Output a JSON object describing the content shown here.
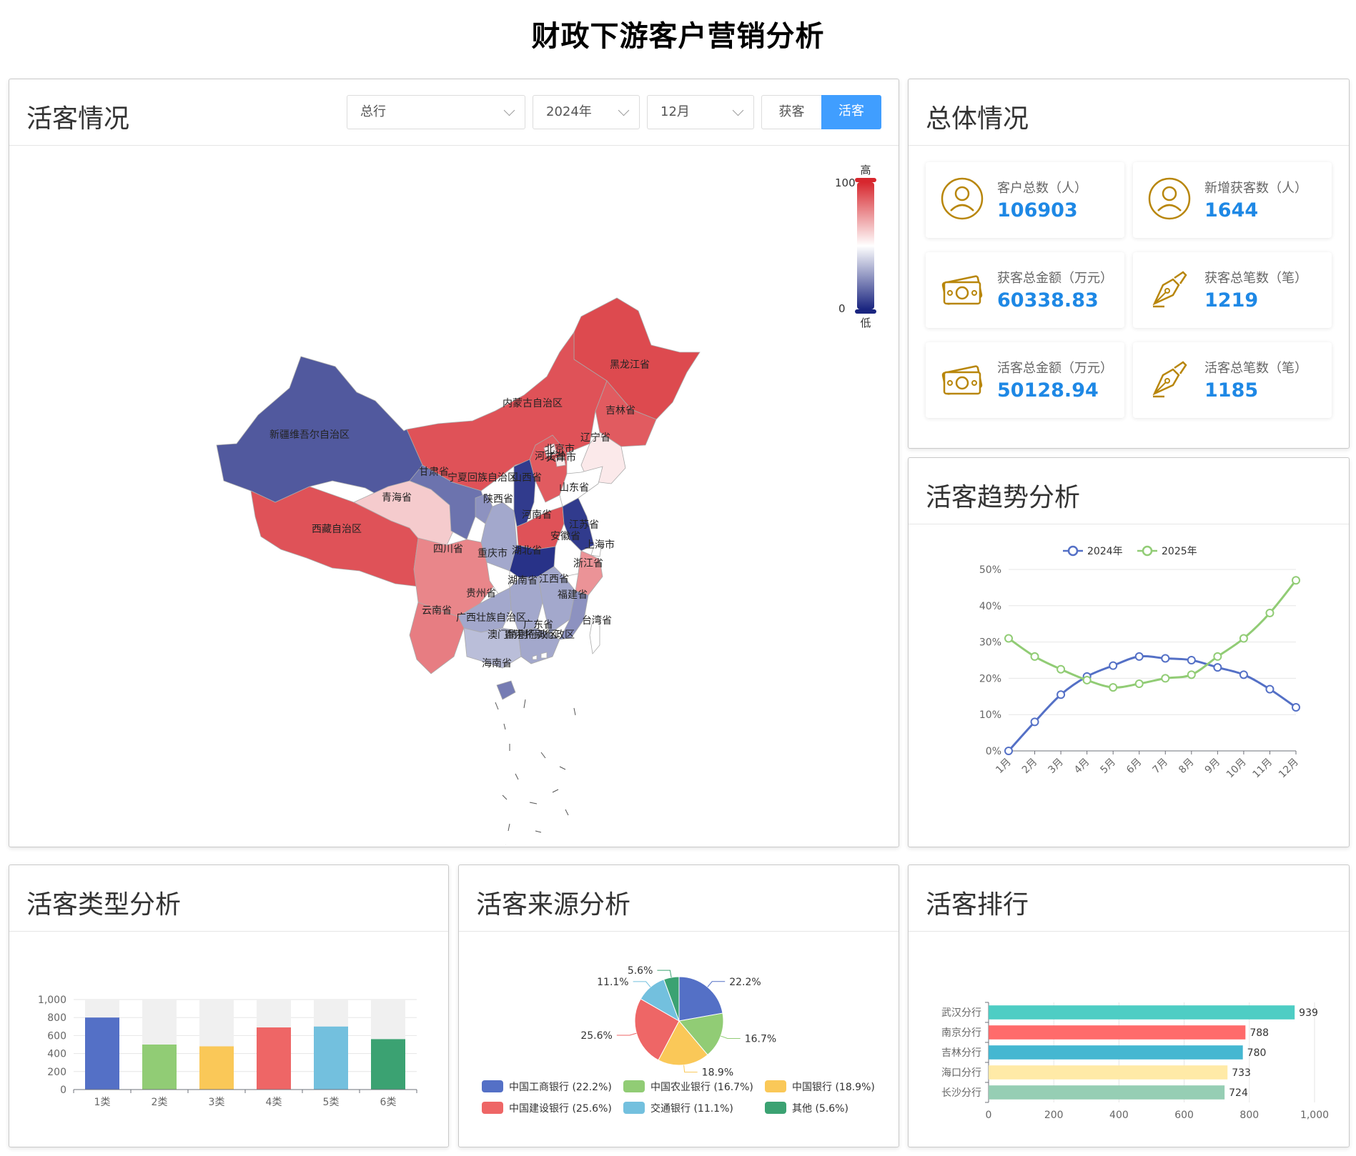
{
  "page_title": "财政下游客户营销分析",
  "map_card": {
    "title": "活客情况",
    "filters": {
      "branch": "总行",
      "year": "2024年",
      "month": "12月"
    },
    "toggle": [
      {
        "label": "获客",
        "active": false
      },
      {
        "label": "活客",
        "active": true
      }
    ],
    "legend": {
      "max_label": "100",
      "min_label": "0",
      "high_label": "高",
      "low_label": "低"
    },
    "provinces": [
      {
        "name": "黑龙江省",
        "level": 0.92
      },
      {
        "name": "吉林省",
        "level": 0.88
      },
      {
        "name": "辽宁省",
        "level": 0.55
      },
      {
        "name": "内蒙古自治区",
        "level": 0.9
      },
      {
        "name": "新疆维吾尔自治区",
        "level": 0.12
      },
      {
        "name": "西藏自治区",
        "level": 0.9
      },
      {
        "name": "青海省",
        "level": 0.62
      },
      {
        "name": "甘肃省",
        "level": 0.18
      },
      {
        "name": "宁夏回族自治区",
        "level": 0.25
      },
      {
        "name": "陕西省",
        "level": 0.3
      },
      {
        "name": "山西省",
        "level": 0.05
      },
      {
        "name": "河北省",
        "level": 0.88
      },
      {
        "name": "北京市",
        "level": 0.55
      },
      {
        "name": "天津市",
        "level": 0.55
      },
      {
        "name": "山东省",
        "level": 0.5
      },
      {
        "name": "河南省",
        "level": 0.9
      },
      {
        "name": "江苏省",
        "level": 0.05
      },
      {
        "name": "安徽省",
        "level": 0.5
      },
      {
        "name": "上海市",
        "level": 0.5
      },
      {
        "name": "浙江省",
        "level": 0.75
      },
      {
        "name": "湖北省",
        "level": 0.03
      },
      {
        "name": "四川省",
        "level": 0.78
      },
      {
        "name": "重庆市",
        "level": 0.5
      },
      {
        "name": "湖南省",
        "level": 0.3
      },
      {
        "name": "江西省",
        "level": 0.3
      },
      {
        "name": "福建省",
        "level": 0.25
      },
      {
        "name": "贵州省",
        "level": 0.3
      },
      {
        "name": "云南省",
        "level": 0.8
      },
      {
        "name": "广西壮族自治区",
        "level": 0.35
      },
      {
        "name": "广东省",
        "level": 0.3
      },
      {
        "name": "台湾省",
        "level": 0.5
      },
      {
        "name": "香港特别行政区",
        "level": 0.5
      },
      {
        "name": "澳门特别行政区",
        "level": 0.5
      },
      {
        "name": "海南省",
        "level": 0.2
      }
    ]
  },
  "overview": {
    "title": "总体情况",
    "stats": [
      {
        "label": "客户总数（人）",
        "value": "106903",
        "icon": "user-icon"
      },
      {
        "label": "新增获客数（人）",
        "value": "1644",
        "icon": "user-icon"
      },
      {
        "label": "获客总金额（万元）",
        "value": "60338.83",
        "icon": "money-icon"
      },
      {
        "label": "获客总笔数（笔）",
        "value": "1219",
        "icon": "pen-icon"
      },
      {
        "label": "活客总金额（万元）",
        "value": "50128.94",
        "icon": "money-icon"
      },
      {
        "label": "活客总笔数（笔）",
        "value": "1185",
        "icon": "pen-icon"
      }
    ]
  },
  "trend": {
    "title": "活客趋势分析",
    "chart_data": {
      "type": "line",
      "x": [
        "1月",
        "2月",
        "3月",
        "4月",
        "5月",
        "6月",
        "7月",
        "8月",
        "9月",
        "10月",
        "11月",
        "12月"
      ],
      "series": [
        {
          "name": "2024年",
          "values": [
            0,
            8,
            15.5,
            20.5,
            23.5,
            26,
            25.5,
            25,
            23,
            21,
            17,
            12
          ],
          "color": "#5470c6"
        },
        {
          "name": "2025年",
          "values": [
            31,
            26,
            22.5,
            19.5,
            17.5,
            18.5,
            20,
            21,
            26,
            31,
            38,
            47
          ],
          "color": "#91cc75"
        }
      ],
      "ylim": [
        0,
        50
      ],
      "yticks": [
        "0%",
        "10%",
        "20%",
        "30%",
        "40%",
        "50%"
      ],
      "legend": "top-center"
    }
  },
  "type_analysis": {
    "title": "活客类型分析",
    "chart_data": {
      "type": "bar",
      "categories": [
        "1类",
        "2类",
        "3类",
        "4类",
        "5类",
        "6类"
      ],
      "values": [
        800,
        500,
        480,
        690,
        700,
        560
      ],
      "colors": [
        "#5470c6",
        "#91cc75",
        "#fac858",
        "#ee6666",
        "#73c0de",
        "#3ba272"
      ],
      "ylim": [
        0,
        1000
      ],
      "yticks": [
        "0",
        "200",
        "400",
        "600",
        "800",
        "1,000"
      ],
      "background_bars": true
    }
  },
  "source_analysis": {
    "title": "活客来源分析",
    "chart_data": {
      "type": "pie",
      "slices": [
        {
          "name": "中国工商银行",
          "value": 22.2,
          "label": "22.2%",
          "legend": "中国工商银行 (22.2%)",
          "color": "#5470c6"
        },
        {
          "name": "中国农业银行",
          "value": 16.7,
          "label": "16.7%",
          "legend": "中国农业银行 (16.7%)",
          "color": "#91cc75"
        },
        {
          "name": "中国银行",
          "value": 18.9,
          "label": "18.9%",
          "legend": "中国银行 (18.9%)",
          "color": "#fac858"
        },
        {
          "name": "中国建设银行",
          "value": 25.6,
          "label": "25.6%",
          "legend": "中国建设银行 (25.6%)",
          "color": "#ee6666"
        },
        {
          "name": "交通银行",
          "value": 11.1,
          "label": "11.1%",
          "legend": "交通银行 (11.1%)",
          "color": "#73c0de"
        },
        {
          "name": "其他",
          "value": 5.6,
          "label": "5.6%",
          "legend": "其他 (5.6%)",
          "color": "#3ba272"
        }
      ]
    }
  },
  "ranking": {
    "title": "活客排行",
    "chart_data": {
      "type": "bar",
      "orientation": "horizontal",
      "categories": [
        "武汉分行",
        "南京分行",
        "吉林分行",
        "海口分行",
        "长沙分行"
      ],
      "values": [
        939,
        788,
        780,
        733,
        724
      ],
      "colors": [
        "#4ecdc4",
        "#ff6b6b",
        "#45b7d1",
        "#ffeaa7",
        "#96ceb4"
      ],
      "xlim": [
        0,
        1000
      ],
      "xticks": [
        "0",
        "200",
        "400",
        "600",
        "800",
        "1,000"
      ]
    }
  }
}
